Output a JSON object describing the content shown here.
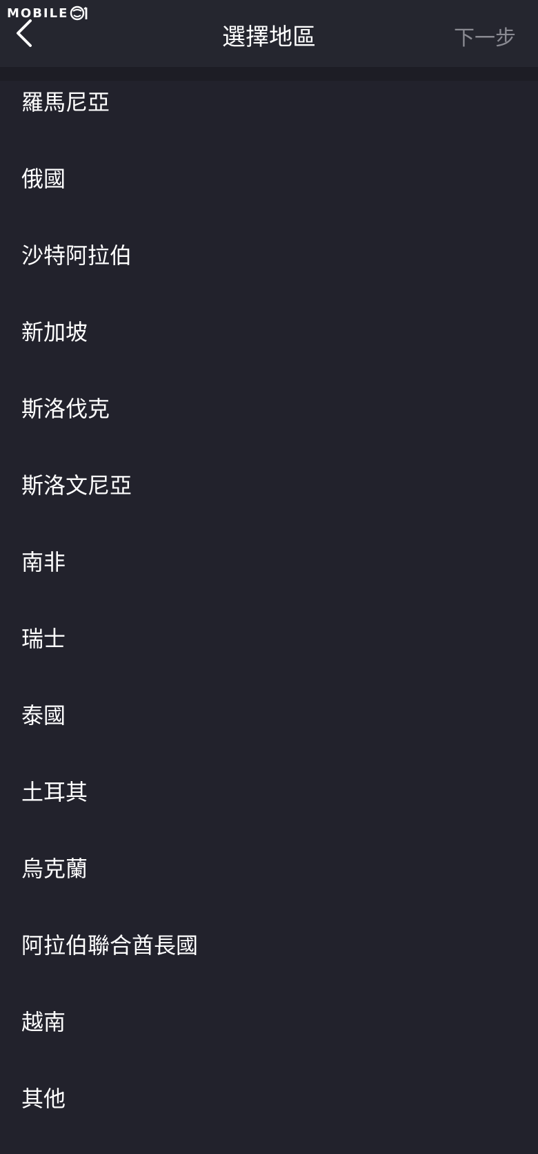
{
  "watermark": {
    "text": "MOBILE01",
    "label_prefix": "MOBILE"
  },
  "header": {
    "title": "選擇地區",
    "next_label": "下一步",
    "back_icon": "chevron-left-icon"
  },
  "regions": [
    {
      "label": "羅馬尼亞"
    },
    {
      "label": "俄國"
    },
    {
      "label": "沙特阿拉伯"
    },
    {
      "label": "新加坡"
    },
    {
      "label": "斯洛伐克"
    },
    {
      "label": "斯洛文尼亞"
    },
    {
      "label": "南非"
    },
    {
      "label": "瑞士"
    },
    {
      "label": "泰國"
    },
    {
      "label": "土耳其"
    },
    {
      "label": "烏克蘭"
    },
    {
      "label": "阿拉伯聯合酋長國"
    },
    {
      "label": "越南"
    },
    {
      "label": "其他"
    }
  ],
  "colors": {
    "background": "#22222c",
    "navbar": "#25262f",
    "next_disabled": "#8a8a92",
    "text": "#ffffff"
  }
}
